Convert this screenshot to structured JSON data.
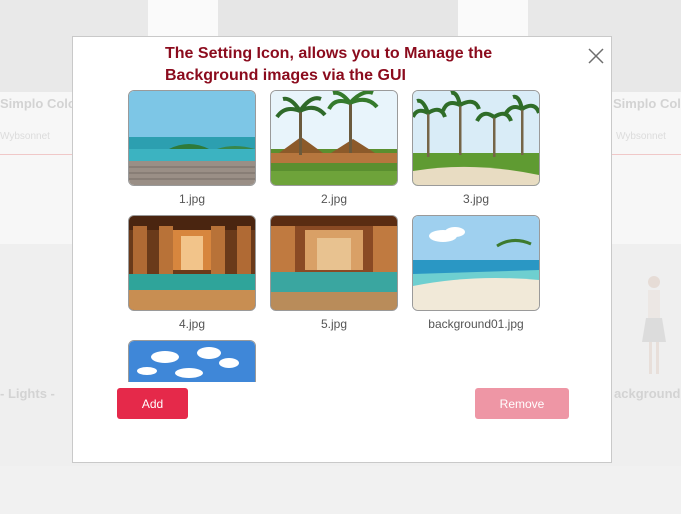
{
  "background_page": {
    "card_titles": [
      "Simplo Colo",
      "Simplo Colo",
      "- Lights -",
      "ackground"
    ],
    "card_subtitles": [
      "Wybsonnet",
      "Wybsonnet"
    ]
  },
  "modal": {
    "title": "The Setting Icon, allows you to Manage the Background images via the GUI",
    "images": [
      {
        "label": "1.jpg",
        "icon": "ocean-pier-photo"
      },
      {
        "label": "2.jpg",
        "icon": "palm-resort-photo"
      },
      {
        "label": "3.jpg",
        "icon": "palm-beach-photo"
      },
      {
        "label": "4.jpg",
        "icon": "pool-pavilion-photo"
      },
      {
        "label": "5.jpg",
        "icon": "pool-courtyard-photo"
      },
      {
        "label": "background01.jpg",
        "icon": "beach-shore-photo"
      },
      {
        "label": "",
        "icon": "sky-clouds-photo"
      }
    ],
    "add_label": "Add",
    "remove_label": "Remove"
  },
  "colors": {
    "title": "#8b0b1d",
    "add_button": "#e5294a",
    "remove_button": "#ee96a5"
  }
}
